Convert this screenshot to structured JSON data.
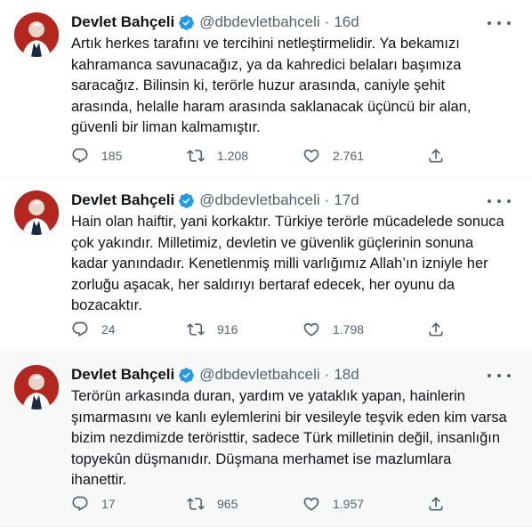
{
  "tweets": [
    {
      "name": "Devlet Bahçeli",
      "handle": "@dbdevletbahceli",
      "separator": "·",
      "time": "16d",
      "text": "Artık herkes tarafını ve tercihini netleştirmelidir. Ya bekamızı kahramanca savunacağız, ya da kahredici belaları başımıza saracağız. Bilinsin ki, terörle huzur arasında, caniyle şehit arasında, helalle haram arasında saklanacak üçüncü bir alan, güvenli bir liman kalmamıştır.",
      "replies": "185",
      "retweets": "1.208",
      "likes": "2.761"
    },
    {
      "name": "Devlet Bahçeli",
      "handle": "@dbdevletbahceli",
      "separator": "·",
      "time": "17d",
      "text": "Hain olan haiftir, yani korkaktır. Türkiye terörle mücadelede sonuca çok yakındır. Milletimiz, devletin ve güvenlik güçlerinin sonuna kadar yanındadır. Kenetlenmiş milli varlığımız Allah’ın izniyle her zorluğu aşacak, her saldırıyı bertaraf edecek, her oyunu da bozacaktır.",
      "replies": "24",
      "retweets": "916",
      "likes": "1.798"
    },
    {
      "name": "Devlet Bahçeli",
      "handle": "@dbdevletbahceli",
      "separator": "·",
      "time": "18d",
      "text": "Terörün arkasında duran, yardım ve yataklık yapan, hainlerin şımarmasını ve kanlı eylemlerini bir vesileyle teşvik eden kim varsa bizim nezdimizde teröristtir, sadece Türk milletinin değil, insanlığın topyekûn düşmanıdır. Düşmana merhamet ise mazlumlara ihanettir.",
      "replies": "17",
      "retweets": "965",
      "likes": "1.957"
    }
  ],
  "icons": {
    "reply": "reply-icon",
    "retweet": "retweet-icon",
    "like": "heart-icon",
    "share": "share-icon",
    "verified": "verified-badge-icon",
    "more": "more-icon"
  },
  "colors": {
    "text": "#0f1419",
    "muted": "#536471",
    "verified": "#1d9bf0",
    "avatar_bg": "#b3271f",
    "shaded_row": "#f7f9f9"
  }
}
